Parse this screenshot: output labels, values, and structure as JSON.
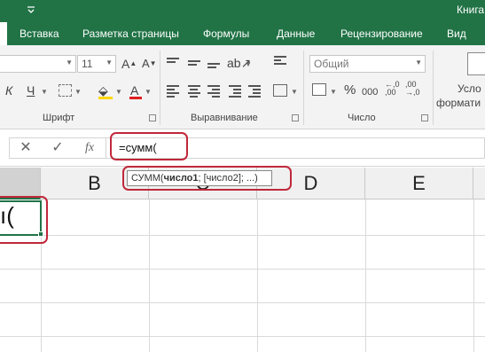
{
  "window": {
    "title": "Книга",
    "qat_icon": "chevron-down-icon"
  },
  "tabs": [
    "Вставка",
    "Разметка страницы",
    "Формулы",
    "Данные",
    "Рецензирование",
    "Вид"
  ],
  "ribbon": {
    "font_size": "11",
    "font_grow": "A",
    "font_shrink": "A",
    "italic": "К",
    "underline": "Ч",
    "font_color_letter": "A",
    "font_group_label": "Шрифт",
    "align_group_label": "Выравнивание",
    "number_format": "Общий",
    "percent": "%",
    "thousands": "000",
    "number_group_label": "Число",
    "cond_format_line1": "Усло",
    "cond_format_line2": "формати"
  },
  "formula_bar": {
    "cancel_symbol": "✕",
    "enter_symbol": "✓",
    "fx_symbol": "fx",
    "value": "=сумм("
  },
  "tooltip": {
    "func": "СУММ(",
    "arg1": "число1",
    "rest": "; [число2]; ...)"
  },
  "columns": [
    "B",
    "C",
    "D",
    "E"
  ],
  "active_cell_text": "ı(",
  "colors": {
    "accent": "#217346",
    "highlight": "#c0283a"
  }
}
